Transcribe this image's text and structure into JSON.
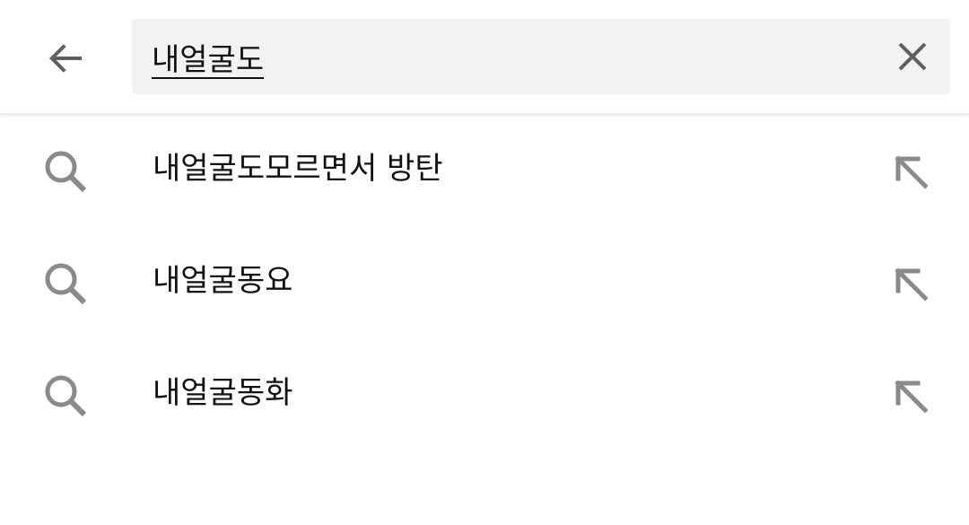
{
  "header": {
    "back_icon": "arrow-left-icon",
    "clear_icon": "close-icon"
  },
  "search": {
    "value": "내얼굴도",
    "placeholder": ""
  },
  "suggestions": [
    {
      "text": "내얼굴도모르면서 방탄",
      "icon": "search-icon",
      "action_icon": "arrow-up-left-icon"
    },
    {
      "text": "내얼굴동요",
      "icon": "search-icon",
      "action_icon": "arrow-up-left-icon"
    },
    {
      "text": "내얼굴동화",
      "icon": "search-icon",
      "action_icon": "arrow-up-left-icon"
    }
  ],
  "colors": {
    "icon_dark": "#5f5f5f",
    "icon_grey": "#8a8a8a",
    "search_bg": "#f2f2f2",
    "text": "#111111"
  }
}
